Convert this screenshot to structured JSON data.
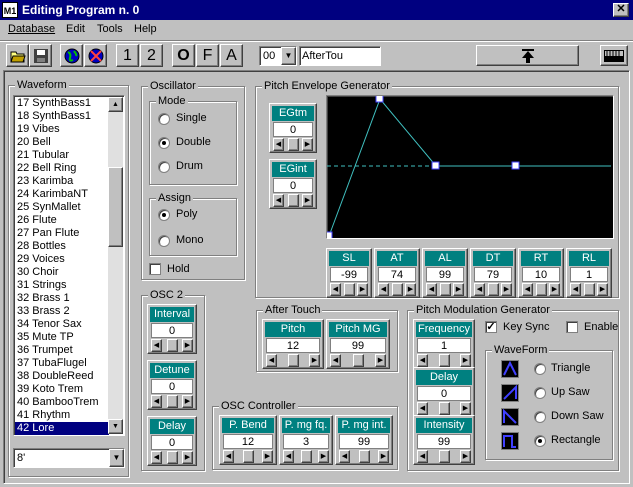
{
  "window": {
    "title": "Editing Program n. 0",
    "app_icon": "M1"
  },
  "menu": [
    "Database",
    "Edit",
    "Tools",
    "Help"
  ],
  "toolbar": {
    "btn1": "1",
    "btn2": "2",
    "btnO": "O",
    "btnF": "F",
    "btnA": "A",
    "program_select": "00",
    "program_name": "AfterTou"
  },
  "waveform": {
    "label": "Waveform",
    "items": [
      "17 SynthBass1",
      "18 SynthBass1",
      "19 Vibes",
      "20 Bell",
      "21 Tubular",
      "22 Bell Ring",
      "23 Karimba",
      "24 KarimbaNT",
      "25 SynMallet",
      "26 Flute",
      "27 Pan Flute",
      "28 Bottles",
      "29 Voices",
      "30 Choir",
      "31 Strings",
      "32 Brass 1",
      "33 Brass 2",
      "34 Tenor Sax",
      "35 Mute TP",
      "36 Trumpet",
      "37 TubaFlugel",
      "38 DoubleReed",
      "39 Koto Trem",
      "40 BambooTrem",
      "41 Rhythm",
      "42 Lore"
    ],
    "selected_index": 25,
    "octave": "8'"
  },
  "oscillator": {
    "label": "Oscillator",
    "mode_label": "Mode",
    "modes": [
      "Single",
      "Double",
      "Drum"
    ],
    "mode_selected": 1,
    "assign_label": "Assign",
    "assigns": [
      "Poly",
      "Mono"
    ],
    "assign_selected": 0,
    "hold": "Hold"
  },
  "osc2": {
    "label": "OSC 2",
    "interval": {
      "name": "Interval",
      "value": "0"
    },
    "detune": {
      "name": "Detune",
      "value": "0"
    },
    "delay": {
      "name": "Delay",
      "value": "0"
    }
  },
  "peg": {
    "label": "Pitch Envelope Generator",
    "egtm": {
      "name": "EGtm",
      "value": "0"
    },
    "egint": {
      "name": "EGint",
      "value": "0"
    },
    "params": [
      {
        "name": "SL",
        "value": "-99"
      },
      {
        "name": "AT",
        "value": "74"
      },
      {
        "name": "AL",
        "value": "99"
      },
      {
        "name": "DT",
        "value": "79"
      },
      {
        "name": "RT",
        "value": "10"
      },
      {
        "name": "RL",
        "value": "1"
      }
    ],
    "colors": {
      "line": "#40c0c0",
      "handle": "#ffffff",
      "bg": "#000000"
    }
  },
  "aftertouch": {
    "label": "After Touch",
    "pitch": {
      "name": "Pitch",
      "value": "12"
    },
    "pitch_mg": {
      "name": "Pitch MG",
      "value": "99"
    }
  },
  "osc_controller": {
    "label": "OSC Controller",
    "pbend": {
      "name": "P. Bend",
      "value": "12"
    },
    "pmgfq": {
      "name": "P. mg fq.",
      "value": "3"
    },
    "pmgint": {
      "name": "P. mg int.",
      "value": "99"
    }
  },
  "pmg": {
    "label": "Pitch Modulation Generator",
    "frequency": {
      "name": "Frequency",
      "value": "1"
    },
    "delay": {
      "name": "Delay",
      "value": "0"
    },
    "intensity": {
      "name": "Intensity",
      "value": "99"
    },
    "keysync": "Key Sync",
    "enable": "Enable",
    "waveform_label": "WaveForm",
    "waves": [
      "Triangle",
      "Up Saw",
      "Down Saw",
      "Rectangle"
    ],
    "wave_selected": 3
  }
}
